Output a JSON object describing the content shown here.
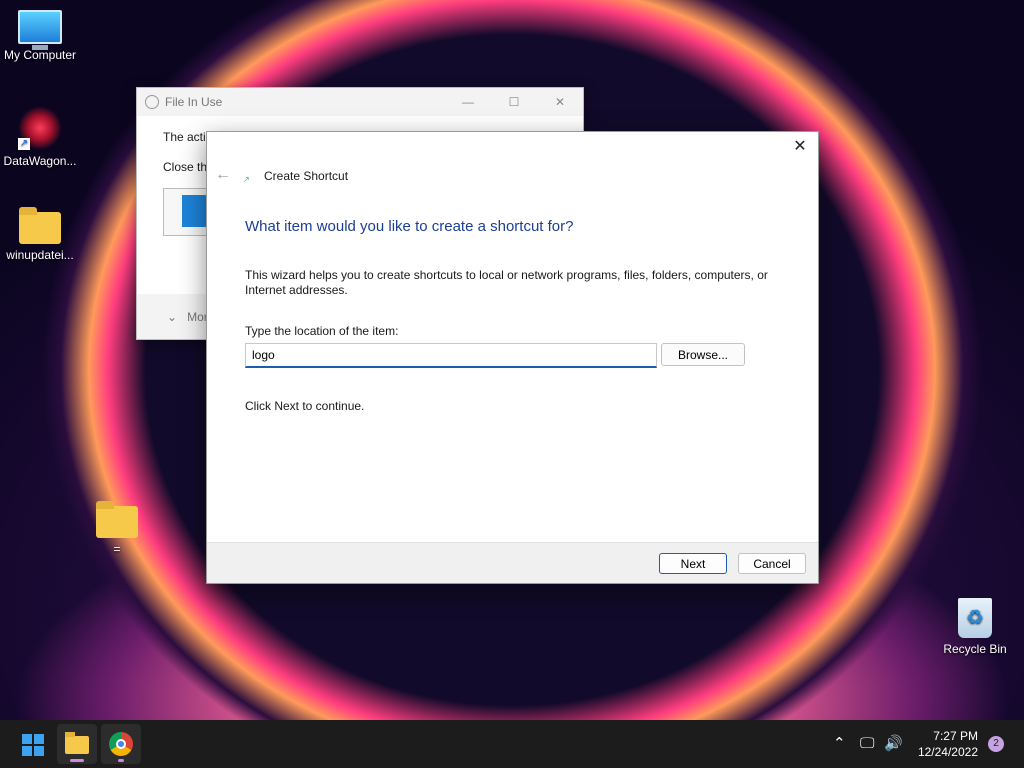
{
  "desktop": {
    "icons": [
      {
        "label": "My Computer",
        "icon": "monitor-icon"
      },
      {
        "label": "DataWagon...",
        "icon": "app-shortcut-icon"
      },
      {
        "label": "winupdatei...",
        "icon": "folder-icon"
      },
      {
        "label": "=",
        "icon": "folder-icon"
      },
      {
        "label": "Recycle Bin",
        "icon": "recycle-bin-icon"
      }
    ]
  },
  "background_window": {
    "title": "File In Use",
    "line1": "The actio",
    "line2": "Close th",
    "more_label": "Mor"
  },
  "dialog": {
    "wizard_title": "Create Shortcut",
    "heading": "What item would you like to create a shortcut for?",
    "description": "This wizard helps you to create shortcuts to local or network programs, files, folders, computers, or Internet addresses.",
    "location_label": "Type the location of the item:",
    "location_value": "logo",
    "browse_label": "Browse...",
    "continue_text": "Click Next to continue.",
    "next_label": "Next",
    "cancel_label": "Cancel",
    "close_glyph": "✕",
    "back_glyph": "←"
  },
  "taskbar": {
    "time": "7:27 PM",
    "date": "12/24/2022",
    "notification_count": "2",
    "accent_color": "#d08ad8"
  }
}
